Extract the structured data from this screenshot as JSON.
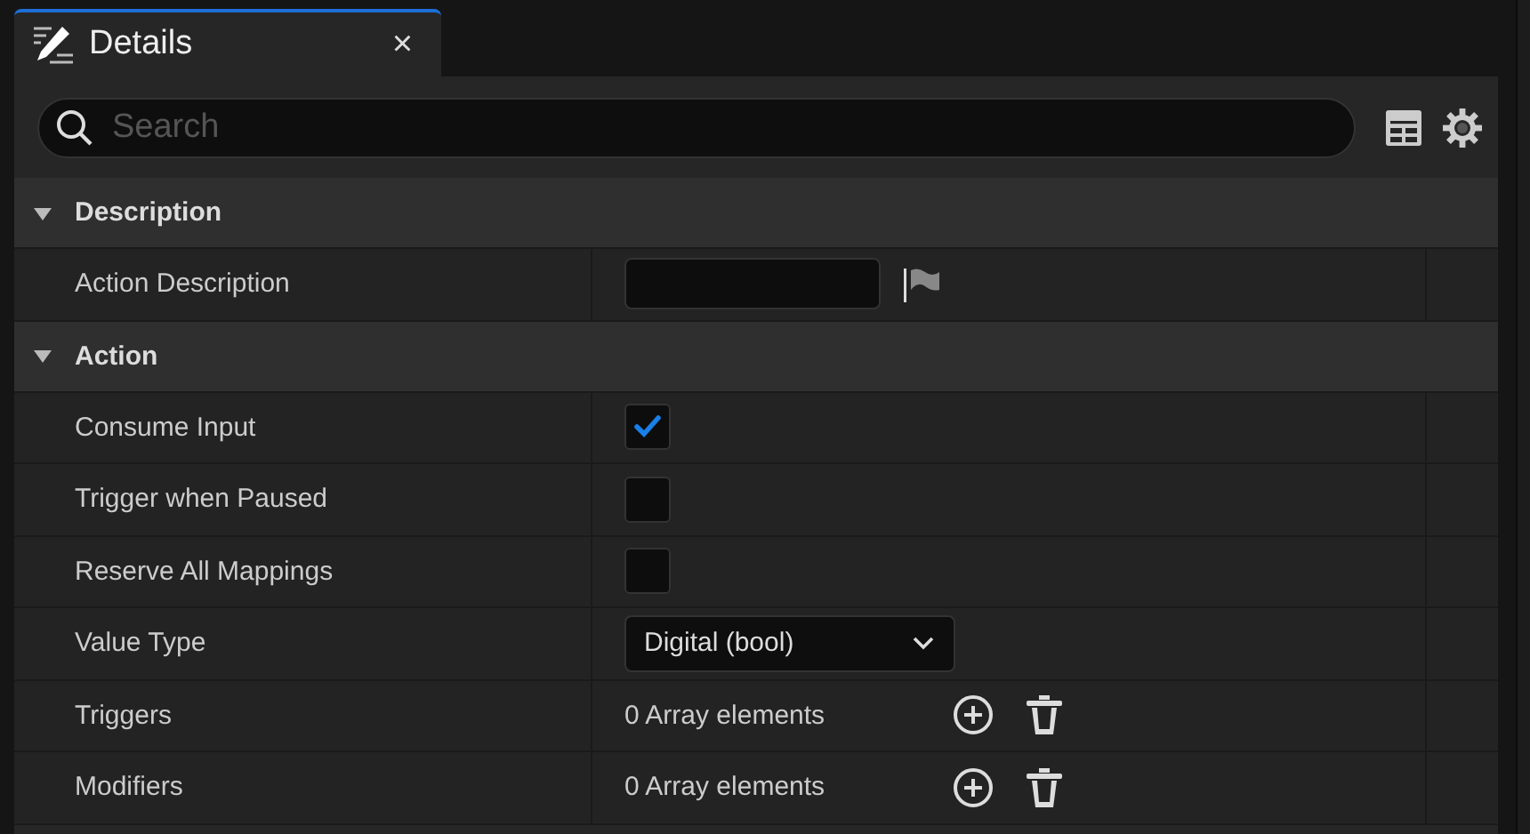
{
  "tab": {
    "title": "Details",
    "close": "×"
  },
  "search": {
    "placeholder": "Search"
  },
  "sections": [
    {
      "title": "Description",
      "expanded": true,
      "rows": [
        {
          "kind": "text",
          "label": "Action Description"
        }
      ]
    },
    {
      "title": "Action",
      "expanded": true,
      "rows": [
        {
          "kind": "checkbox",
          "label": "Consume Input",
          "checked": true
        },
        {
          "kind": "checkbox",
          "label": "Trigger when Paused",
          "checked": false
        },
        {
          "kind": "checkbox",
          "label": "Reserve All Mappings",
          "checked": false
        },
        {
          "kind": "dropdown",
          "label": "Value Type",
          "value": "Digital (bool)"
        },
        {
          "kind": "array",
          "label": "Triggers",
          "value": "0 Array elements"
        },
        {
          "kind": "array",
          "label": "Modifiers",
          "value": "0 Array elements"
        }
      ]
    }
  ]
}
